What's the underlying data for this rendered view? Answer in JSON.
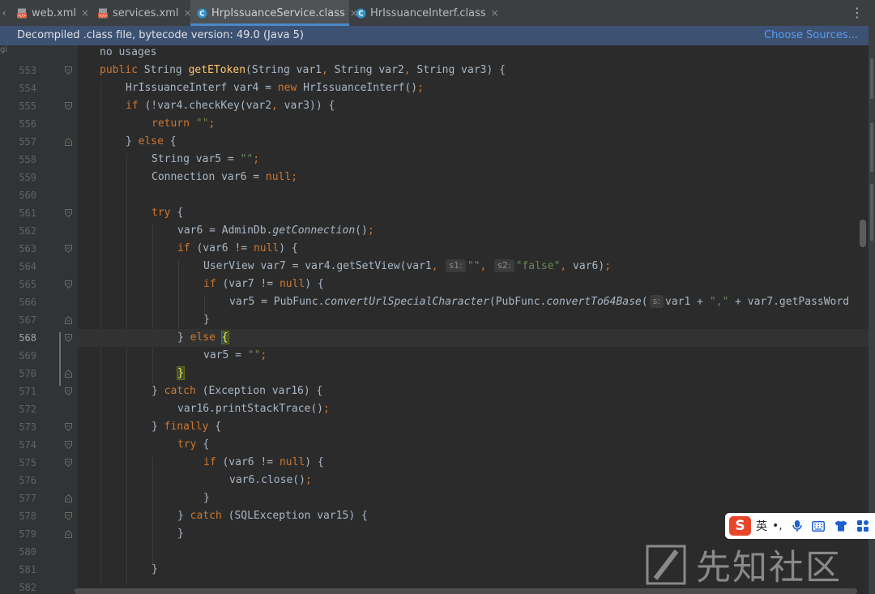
{
  "tabs": [
    {
      "label": "web.xml",
      "icon": "xml-file-icon",
      "active": false
    },
    {
      "label": "services.xml",
      "icon": "xml-file-icon",
      "active": false
    },
    {
      "label": "HrpIssuanceService.class",
      "icon": "class-file-icon",
      "active": true
    },
    {
      "label": "HrIssuanceInterf.class",
      "icon": "class-file-icon",
      "active": false
    }
  ],
  "tab_close_glyph": "×",
  "tab_menu_glyph": "⋮",
  "left_fragment": "gi",
  "banner": {
    "message": "Decompiled .class file, bytecode version: 49.0 (Java 5)",
    "action": "Choose Sources..."
  },
  "editor": {
    "usage_hint": "no usages",
    "line_numbers": [
      "553",
      "554",
      "555",
      "556",
      "557",
      "558",
      "559",
      "560",
      "561",
      "562",
      "563",
      "564",
      "565",
      "566",
      "567",
      "568",
      "569",
      "570",
      "571",
      "572",
      "573",
      "574",
      "575",
      "576",
      "577",
      "578",
      "579",
      "580",
      "581",
      "582"
    ],
    "current_line": "568"
  },
  "code": {
    "l553": {
      "k1": "public ",
      "t1": "String ",
      "fn": "getEToken",
      "t2": "(String var1",
      "c1": ",",
      "t3": " String var2",
      "c2": ",",
      "t4": " String var3) {"
    },
    "l554": {
      "t1": "HrIssuanceInterf var4 = ",
      "k1": "new ",
      "t2": "HrIssuanceInterf()",
      "sc": ";"
    },
    "l555": {
      "k1": "if ",
      "t1": "(!var4.checkKey(var2",
      "c1": ",",
      "t2": " var3)) {"
    },
    "l556": {
      "k1": "return ",
      "s1": "\"\"",
      "sc": ";"
    },
    "l557": {
      "t1": "} ",
      "k1": "else ",
      "t2": "{"
    },
    "l558": {
      "t1": "String var5 = ",
      "s1": "\"\"",
      "sc": ";"
    },
    "l559": {
      "t1": "Connection var6 = ",
      "k1": "null",
      "sc": ";"
    },
    "l561": {
      "k1": "try ",
      "t1": "{"
    },
    "l562": {
      "t1": "var6 = AdminDb.",
      "it": "getConnection",
      "t2": "()",
      "sc": ";"
    },
    "l563": {
      "k1": "if ",
      "t1": "(var6 != ",
      "k2": "null",
      "t2": ") {"
    },
    "l564": {
      "t1": "UserView var7 = var4.getSetView(var1",
      "c1": ",",
      "h1": "s1:",
      "s1": "\"\"",
      "c2": ",",
      "h2": "s2:",
      "s2": "\"false\"",
      "c3": ",",
      "t2": " var6)",
      "sc": ";"
    },
    "l565": {
      "k1": "if ",
      "t1": "(var7 != ",
      "k2": "null",
      "t2": ") {"
    },
    "l566": {
      "t1": "var5 = PubFunc.",
      "it1": "convertUrlSpecialCharacter",
      "t2": "(PubFunc.",
      "it2": "convertTo64Base",
      "t3": "(",
      "h1": "s:",
      "t4": "var1 + ",
      "s1": "\",\"",
      "t5": " + var7.getPassWord"
    },
    "l567": {
      "t1": "}"
    },
    "l568": {
      "t1": "} ",
      "k1": "else ",
      "b1": "{"
    },
    "l569": {
      "t1": "var5 = ",
      "s1": "\"\"",
      "sc": ";"
    },
    "l570": {
      "b1": "}"
    },
    "l571": {
      "t1": "} ",
      "k1": "catch ",
      "t2": "(Exception var16) {"
    },
    "l572": {
      "t1": "var16.printStackTrace()",
      "sc": ";"
    },
    "l573": {
      "t1": "} ",
      "k1": "finally ",
      "t2": "{"
    },
    "l574": {
      "k1": "try ",
      "t1": "{"
    },
    "l575": {
      "k1": "if ",
      "t1": "(var6 != ",
      "k2": "null",
      "t2": ") {"
    },
    "l576": {
      "t1": "var6.close()",
      "sc": ";"
    },
    "l577": {
      "t1": "}"
    },
    "l578": {
      "t1": "} ",
      "k1": "catch ",
      "t2": "(SQLException var15) {"
    },
    "l579": {
      "t1": "}"
    },
    "l581": {
      "t1": "}"
    }
  },
  "ime_toolbar": {
    "logo": "S",
    "lang": "英",
    "punct": "•,",
    "items": [
      "mic-icon",
      "keyboard-icon",
      "shirt-icon",
      "apps-icon"
    ]
  },
  "watermark": {
    "text": "先知社区"
  },
  "colors": {
    "keyword": "#cc7832",
    "method": "#ffc66d",
    "string": "#6a8759",
    "text": "#a9b7c6",
    "banner_bg": "#3d5272",
    "link": "#589df6"
  }
}
